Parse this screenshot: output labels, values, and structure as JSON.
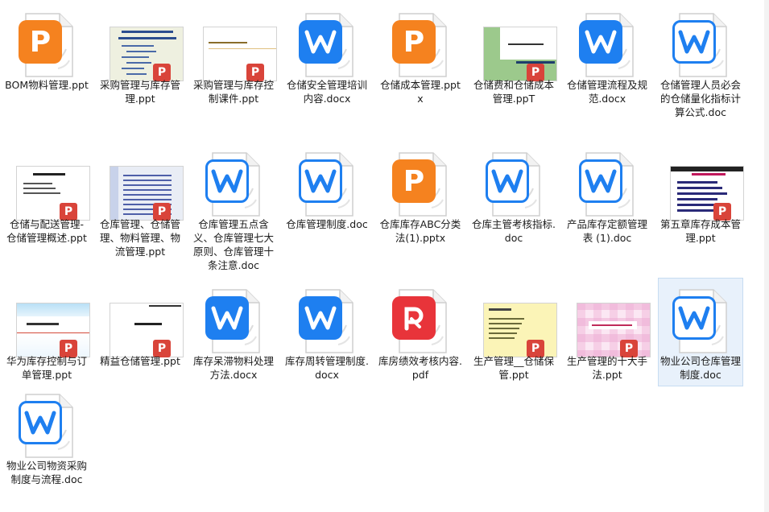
{
  "files": [
    {
      "name": "BOM物料管理.ppt",
      "kind": "ppt-app"
    },
    {
      "name": "采购管理与库存管理.ppt",
      "kind": "slide",
      "slide": "kaigan"
    },
    {
      "name": "采购管理与库存控制课件.ppt",
      "kind": "slide",
      "slide": "plain-title"
    },
    {
      "name": "仓储安全管理培训内容.docx",
      "kind": "wps-docx"
    },
    {
      "name": "仓储成本管理.pptx",
      "kind": "ppt-app"
    },
    {
      "name": "仓储费和仓储成本管理.ppT",
      "kind": "slide",
      "slide": "green-band"
    },
    {
      "name": "仓储管理流程及规范.docx",
      "kind": "wps-docx"
    },
    {
      "name": "仓储管理人员必会的仓储量化指标计算公式.doc",
      "kind": "wps-doc"
    },
    {
      "name": "仓储与配送管理-仓储管理概述.ppt",
      "kind": "slide",
      "slide": "text-lines"
    },
    {
      "name": "仓库管理、仓储管理、物料管理、物流管理.ppt",
      "kind": "slide",
      "slide": "blue-dots"
    },
    {
      "name": "仓库管理五点含义、仓库管理七大原则、仓库管理十条注意.doc",
      "kind": "wps-doc"
    },
    {
      "name": "仓库管理制度.doc",
      "kind": "wps-doc"
    },
    {
      "name": "仓库库存ABC分类法(1).pptx",
      "kind": "ppt-app"
    },
    {
      "name": "仓库主管考核指标.doc",
      "kind": "wps-doc"
    },
    {
      "name": "产品库存定额管理表 (1).doc",
      "kind": "wps-doc"
    },
    {
      "name": "第五章库存成本管理.ppt",
      "kind": "slide",
      "slide": "dark-list"
    },
    {
      "name": "华为库存控制与订单管理.ppt",
      "kind": "slide",
      "slide": "sky-band"
    },
    {
      "name": "精益仓储管理.ppt",
      "kind": "slide",
      "slide": "center-title"
    },
    {
      "name": "库存呆滞物料处理方法.docx",
      "kind": "wps-docx"
    },
    {
      "name": "库存周转管理制度.docx",
      "kind": "wps-docx"
    },
    {
      "name": "库房绩效考核内容.pdf",
      "kind": "pdf-app"
    },
    {
      "name": "生产管理__仓储保管.ppt",
      "kind": "slide",
      "slide": "yellow"
    },
    {
      "name": "生产管理的十大手法.ppt",
      "kind": "slide",
      "slide": "pink-grid"
    },
    {
      "name": "物业公司仓库管理制度.doc",
      "kind": "wps-doc",
      "selected": true
    },
    {
      "name": "物业公司物资采购制度与流程.doc",
      "kind": "wps-doc"
    }
  ],
  "icons": {
    "ppt_letter": "P",
    "wps_letter": "W",
    "ppt_mini_letter": "P"
  },
  "colors": {
    "ppt_orange": "#f5821f",
    "wps_blue": "#1e7ff0",
    "pdf_red": "#e8343a",
    "ppt_badge": "#d9443a",
    "selection_bg": "#e8f1fb"
  }
}
